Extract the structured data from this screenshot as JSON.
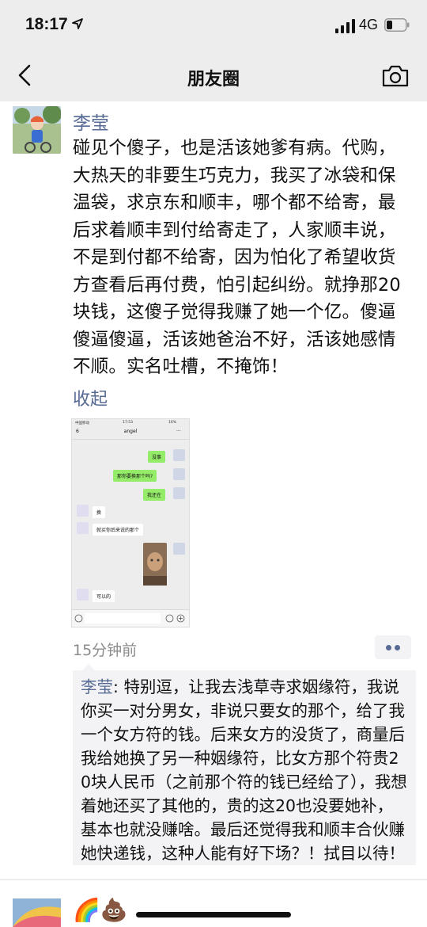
{
  "status_bar": {
    "time": "18:17",
    "network": "4G",
    "icons": [
      "location-arrow-icon",
      "signal-icon",
      "battery-icon"
    ]
  },
  "nav": {
    "title": "朋友圈",
    "back_icon": "chevron-left-icon",
    "camera_icon": "camera-icon"
  },
  "post": {
    "author": "李莹",
    "text": "碰见个傻子，也是活该她爹有病。代购，大热天的非要生巧克力，我买了冰袋和保温袋，求京东和顺丰，哪个都不给寄，最后求着顺丰到付给寄走了，人家顺丰说，不是到付都不给寄，因为怕化了希望收货方查看后再付费，怕引起纠纷。就挣那20块钱，这傻子觉得我赚了她一个亿。傻逼傻逼傻逼，活该她爸治不好，活该她感情不顺。实名吐槽，不掩饰！",
    "collapse_label": "收起",
    "time": "15分钟前",
    "image": {
      "status_carrier": "中国移动",
      "status_time": "17:53",
      "status_battery": "16%",
      "back_count": "6",
      "contact": "angel",
      "more": "···",
      "messages": [
        {
          "from": "me",
          "text": "没事"
        },
        {
          "from": "me",
          "text": "那你要换那个吗?"
        },
        {
          "from": "me",
          "text": "我还在"
        },
        {
          "from": "them",
          "text": "换"
        },
        {
          "from": "them",
          "text": "就买你后来说的那个"
        },
        {
          "from": "them",
          "text": "可以的"
        }
      ]
    }
  },
  "comment": {
    "author": "李莹",
    "separator": ": ",
    "text": "特别逗，让我去浅草寺求姻缘符，我说你买一对分男女，非说只要女的那个，给了我一个女方符的钱。后来女方的没货了，商量后我给她换了另一种姻缘符，比女方那个符贵20块人民币（之前那个符的钱已经给了），我想着她还买了其他的，贵的这20也没要她补，基本也就没赚啥。最后还觉得我和顺丰合伙赚她快递钱，这种人能有好下场？！拭目以待！"
  },
  "next_post": {
    "emoji": "🌈💩"
  },
  "colors": {
    "link": "#576b95",
    "background_bar": "#ededed",
    "comment_bg": "#f3f3f5",
    "bubble_me": "#95ec69"
  }
}
